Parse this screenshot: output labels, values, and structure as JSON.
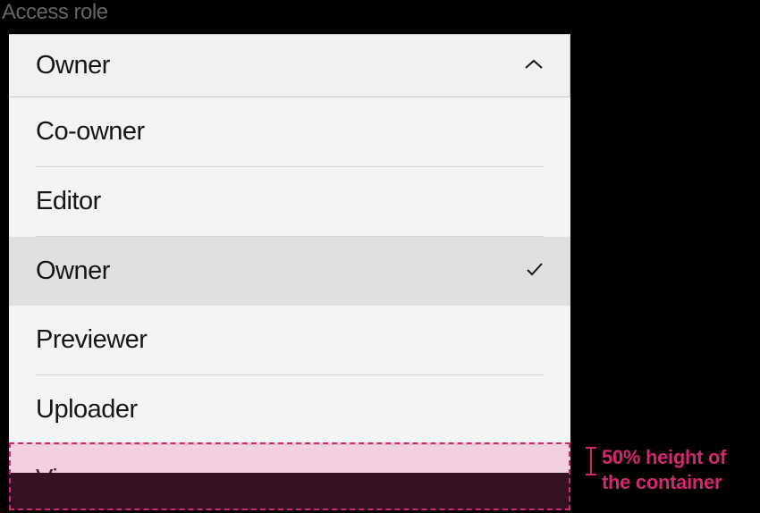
{
  "field_label": "Access role",
  "dropdown": {
    "selected_value": "Owner",
    "options": [
      {
        "label": "Co-owner",
        "selected": false
      },
      {
        "label": "Editor",
        "selected": false
      },
      {
        "label": "Owner",
        "selected": true
      },
      {
        "label": "Previewer",
        "selected": false
      },
      {
        "label": "Uploader",
        "selected": false
      },
      {
        "label": "Viewer",
        "selected": false
      }
    ]
  },
  "annotation": {
    "text_line1": "50% height of",
    "text_line2": "the container"
  },
  "colors": {
    "annotation": "#d12771",
    "selected_bg": "#e0e0e0",
    "menu_bg": "#f4f4f4",
    "trigger_bg": "#f1f1f1"
  }
}
